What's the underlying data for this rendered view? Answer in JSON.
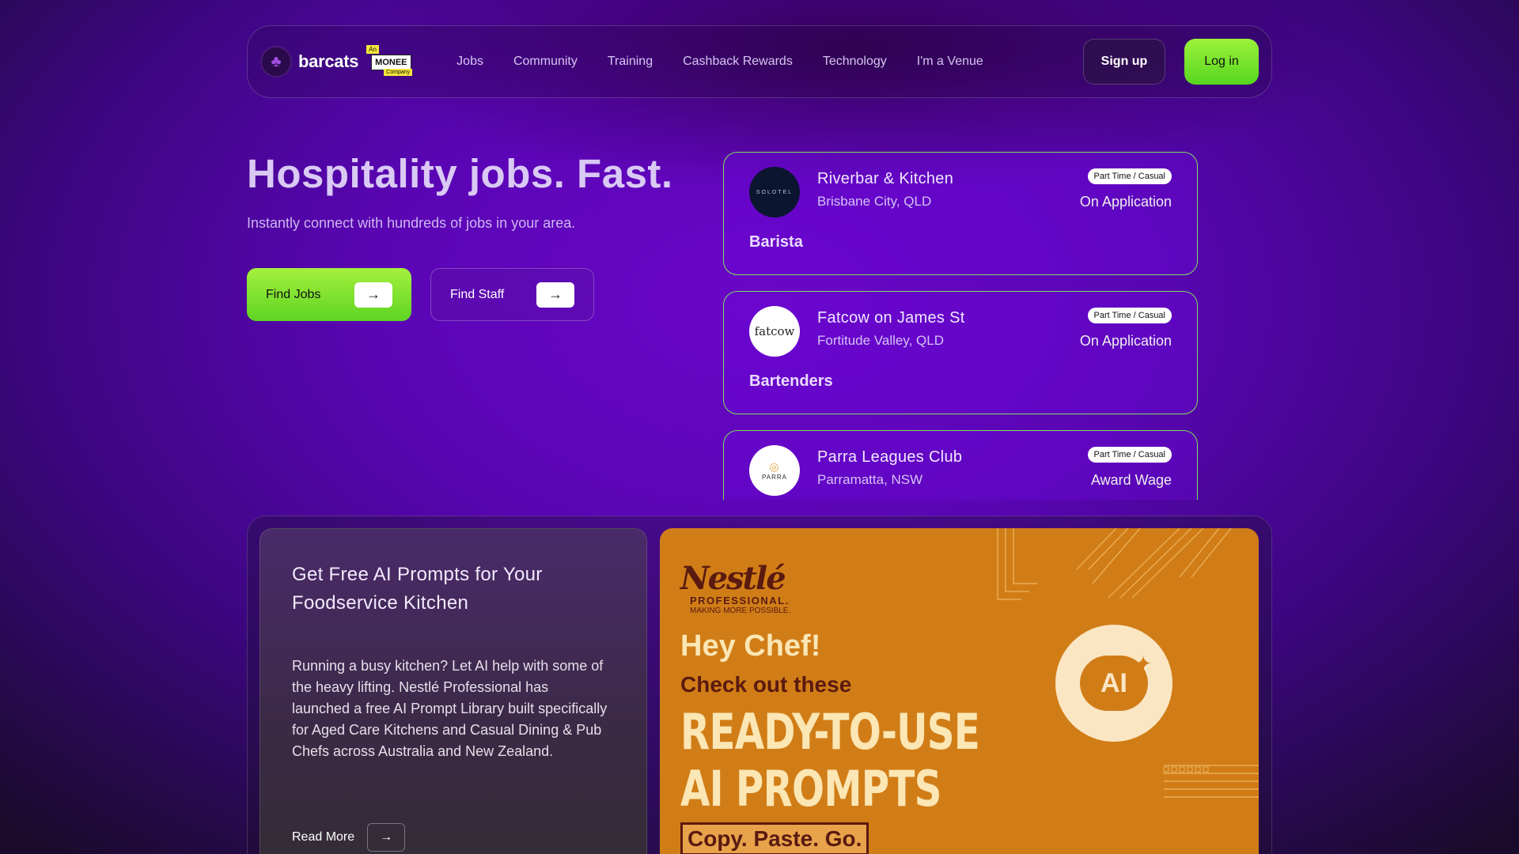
{
  "nav": {
    "brand": "barcats",
    "company_badge": {
      "an": "An",
      "name": "MONEE",
      "company": "Company"
    },
    "menu": [
      "Jobs",
      "Community",
      "Training",
      "Cashback Rewards",
      "Technology",
      "I'm a Venue"
    ],
    "signup": "Sign up",
    "login": "Log in"
  },
  "hero": {
    "title": "Hospitality jobs. Fast.",
    "subtitle": "Instantly connect with hundreds of jobs in your area.",
    "find_jobs": "Find Jobs",
    "find_staff": "Find Staff"
  },
  "jobs": [
    {
      "venue": "Riverbar & Kitchen",
      "location": "Brisbane City, QLD",
      "type": "Part Time / Casual",
      "pay": "On Application",
      "role": "Barista",
      "logo_text": "SOLOTEL"
    },
    {
      "venue": "Fatcow on James St",
      "location": "Fortitude Valley, QLD",
      "type": "Part Time / Casual",
      "pay": "On Application",
      "role": "Bartenders",
      "logo_text": "fatcow"
    },
    {
      "venue": "Parra Leagues Club",
      "location": "Parramatta, NSW",
      "type": "Part Time / Casual",
      "pay": "Award Wage",
      "role": "",
      "logo_text": "PARRA"
    }
  ],
  "feature": {
    "title": "Get Free AI Prompts for Your Foodservice Kitchen",
    "body": "Running a busy kitchen? Let AI help with some of the heavy lifting. Nestlé Professional has launched a free AI Prompt Library built specifically for Aged Care Kitchens and Casual Dining & Pub Chefs across Australia and New Zealand.",
    "read_more": "Read More"
  },
  "banner": {
    "brand": "Nestlé",
    "brand_sub": "PROFESSIONAL.",
    "brand_tagline": "MAKING MORE POSSIBLE.",
    "hey": "Hey Chef!",
    "check": "Check out these",
    "headline_1": "READY-TO-USE",
    "headline_2": "AI PROMPTS",
    "copy": "Copy. Paste. Go.",
    "icon_text": "AI"
  },
  "colors": {
    "accent_green": "#7fe15b",
    "brand_purple": "#5a05b4",
    "banner_orange": "#d17d17"
  }
}
